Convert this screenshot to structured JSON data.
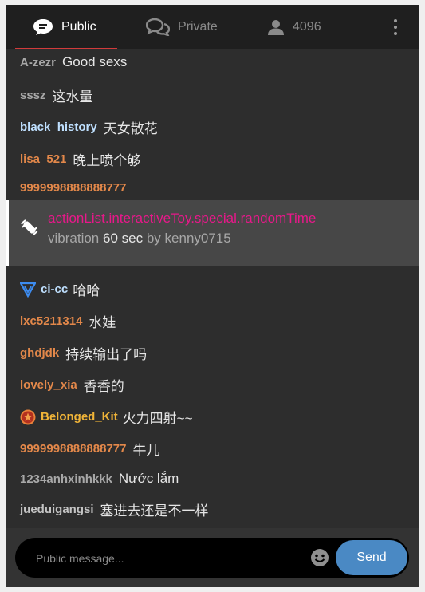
{
  "tabs": {
    "public_label": "Public",
    "private_label": "Private",
    "user_count": "4096"
  },
  "messages": [
    {
      "user": "A-zezr",
      "text": "Good sexs"
    },
    {
      "user": "sssz",
      "text": "这水量"
    },
    {
      "user": "black_history",
      "text": "天女散花"
    },
    {
      "user": "lisa_521",
      "text": "晚上喷个够"
    },
    {
      "user": "9999998888888777",
      "text": ""
    },
    {
      "user": "ci-cc",
      "text": "哈哈"
    },
    {
      "user": "lxc5211314",
      "text": "水娃"
    },
    {
      "user": "ghdjdk",
      "text": "持续输出了吗"
    },
    {
      "user": "lovely_xia",
      "text": "香香的"
    },
    {
      "user": "Belonged_Kit",
      "text": "火力四射~~"
    },
    {
      "user": "9999998888888777",
      "text": "牛儿"
    },
    {
      "user": "1234anhxinhkkk",
      "text": "Nước lắm"
    },
    {
      "user": "jueduigangsi",
      "text": "塞进去还是不一样"
    }
  ],
  "alert": {
    "title": "actionList.interactiveToy.special.randomTime",
    "prefix": "vibration",
    "duration": "60 sec",
    "by": "by",
    "user": "kenny0715"
  },
  "composer": {
    "placeholder": "Public message...",
    "send_label": "Send"
  },
  "colors": {
    "accent_tab": "#d13b3b",
    "send_button": "#4a89c4",
    "alert_title": "#e8188a",
    "username_orange": "#e3884a"
  },
  "icons": {
    "public_tab": "speech-bubble-icon",
    "private_tab": "two-speech-bubbles-icon",
    "users": "user-icon",
    "menu": "kebab-menu-icon",
    "alert": "toy-vibration-icon",
    "ci_cc_badge": "v-shield-badge-icon",
    "belonged_kit_badge": "star-badge-icon",
    "emoji": "smiley-icon"
  }
}
